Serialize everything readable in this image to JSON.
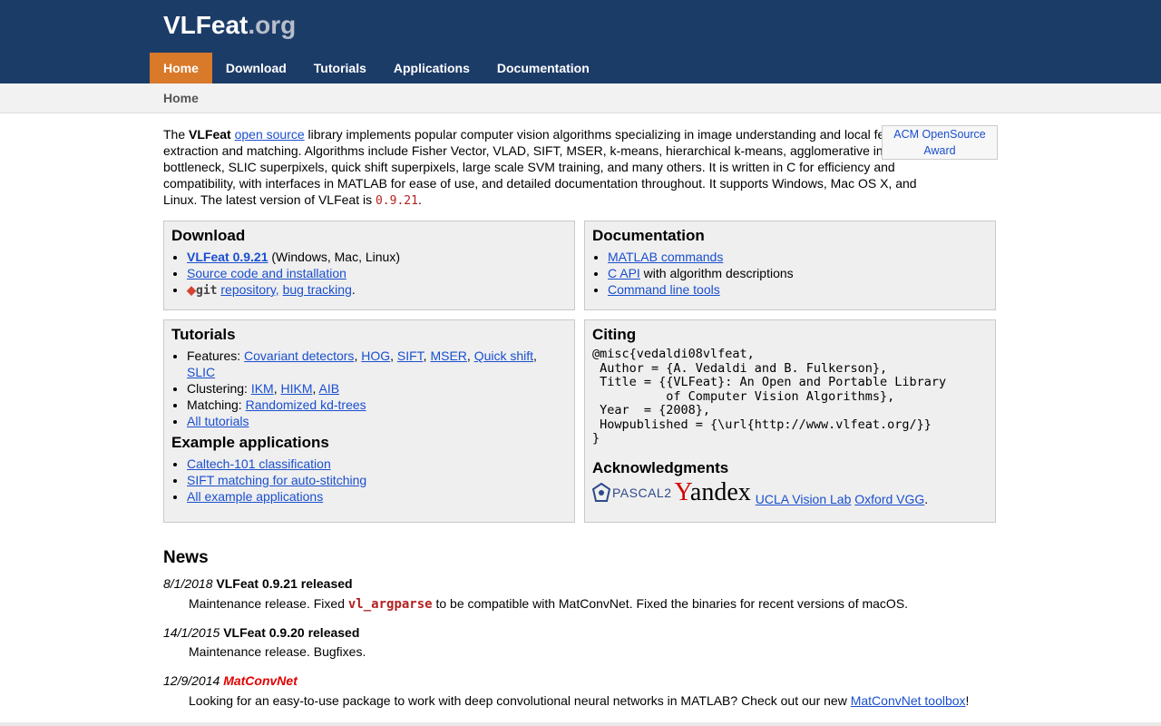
{
  "header": {
    "logo_main": "VLFeat",
    "logo_suffix": ".org",
    "nav": [
      "Home",
      "Download",
      "Tutorials",
      "Applications",
      "Documentation"
    ],
    "active_nav": "Home"
  },
  "breadcrumb": "Home",
  "intro": {
    "p1": "The ",
    "name": "VLFeat",
    "p2": " ",
    "open_source": "open source",
    "p3": " library implements popular computer vision algorithms specializing in image understanding and local features extraction and matching. Algorithms include Fisher Vector, VLAD, SIFT, MSER, k-means, hierarchical k-means, agglomerative information bottleneck, SLIC superpixels, quick shift superpixels, large scale SVM training, and many others. It is written in C for efficiency and compatibility, with interfaces in MATLAB for ease of use, and detailed documentation throughout. It supports Windows, Mac OS X, and Linux. The latest version of VLFeat is ",
    "version": "0.9.21",
    "p4": "."
  },
  "award": {
    "line1": "ACM OpenSource",
    "line2": "Award"
  },
  "download": {
    "title": "Download",
    "item1_link": "VLFeat 0.9.21",
    "item1_rest": " (Windows, Mac, Linux)",
    "item2_link": "Source code and installation",
    "git_label": "git",
    "repo_link": "repository,",
    "bug_link": "bug tracking",
    "item3_end": "."
  },
  "documentation": {
    "title": "Documentation",
    "item1": "MATLAB commands",
    "item2_link": "C API",
    "item2_rest": " with algorithm descriptions",
    "item3": "Command line tools"
  },
  "tutorials": {
    "title": "Tutorials",
    "features_label": "Features: ",
    "features": [
      "Covariant detectors",
      "HOG",
      "SIFT",
      "MSER",
      "Quick shift",
      "SLIC"
    ],
    "clustering_label": "Clustering: ",
    "clustering": [
      "IKM",
      "HIKM",
      "AIB"
    ],
    "matching_label": "Matching: ",
    "matching": "Randomized kd-trees",
    "all": "All tutorials"
  },
  "examples": {
    "title": "Example applications",
    "items": [
      "Caltech-101 classification",
      "SIFT matching for auto-stitching",
      "All example applications"
    ]
  },
  "citing": {
    "title": "Citing",
    "bibtex": "@misc{vedaldi08vlfeat,\n Author = {A. Vedaldi and B. Fulkerson},\n Title = {{VLFeat}: An Open and Portable Library\n          of Computer Vision Algorithms},\n Year  = {2008},\n Howpublished = {\\url{http://www.vlfeat.org/}}\n}"
  },
  "acknowledgments": {
    "title": "Acknowledgments",
    "pascal": "PASCAL2",
    "yandex_y": "Y",
    "yandex_rest": "andex",
    "ucla": "UCLA Vision Lab",
    "oxford": "Oxford VGG",
    "end": "."
  },
  "news": {
    "title": "News",
    "items": [
      {
        "date": "8/1/2018",
        "headline": "VLFeat 0.9.21 released",
        "body_pre": "Maintenance release. Fixed ",
        "body_code": "vl_argparse",
        "body_post": " to be compatible with MatConvNet. Fixed the binaries for recent versions of macOS."
      },
      {
        "date": "14/1/2015",
        "headline": "VLFeat 0.9.20 released",
        "body": "Maintenance release. Bugfixes."
      },
      {
        "date": "12/9/2014",
        "headline": "MatConvNet",
        "body_pre": "Looking for an easy-to-use package to work with deep convolutional neural networks in MATLAB? Check out our new ",
        "body_link": "MatConvNet toolbox",
        "body_post": "!"
      }
    ]
  }
}
